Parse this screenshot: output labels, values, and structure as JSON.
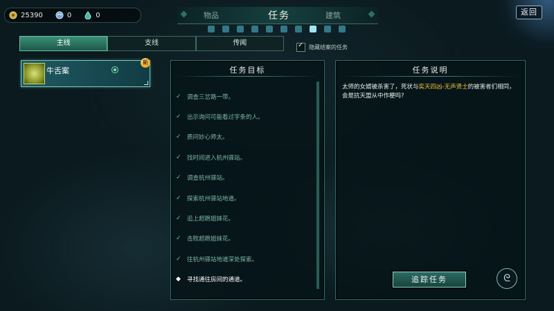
{
  "currency": [
    {
      "icon": "coin-icon",
      "value": "25390"
    },
    {
      "icon": "orb-icon",
      "value": "0"
    },
    {
      "icon": "spirit-drop-icon",
      "value": "0"
    }
  ],
  "top_tabs": {
    "items": "物品",
    "quest": "任务",
    "build": "建筑"
  },
  "return_label": "返回",
  "sub_tabs": [
    "主线",
    "支线",
    "传闻"
  ],
  "hide_completed_label": "隐藏结案的任务",
  "quest_card": {
    "name": "牛舌案",
    "badge": "新"
  },
  "objectives": {
    "title": "任务目标",
    "items": [
      {
        "text": "调查三岔路一带。",
        "done": true
      },
      {
        "text": "出示询问可能看过字条的人。",
        "done": true
      },
      {
        "text": "质问妙心师太。",
        "done": true
      },
      {
        "text": "找时间进入杭州驿站。",
        "done": true
      },
      {
        "text": "调查杭州驿站。",
        "done": true
      },
      {
        "text": "探索杭州驿站地道。",
        "done": true
      },
      {
        "text": "追上超跑姐妹花。",
        "done": true
      },
      {
        "text": "击败超跑姐妹花。",
        "done": true
      },
      {
        "text": "往杭州驿站地道深处探索。",
        "done": true
      },
      {
        "text": "寻找通往房间的通道。",
        "done": false
      }
    ]
  },
  "description": {
    "title": "任务说明",
    "text_before": "太师的女婿被杀害了，死状与",
    "highlight": "奕天四凶-无声贤士",
    "text_after": "的被害者们相同，会是抗天盟从中作梗吗?"
  },
  "track_button_label": "追踪任务",
  "colors": {
    "accent": "#3b8f77",
    "highlight": "#f2c23a",
    "done": "#7fb7a6"
  }
}
